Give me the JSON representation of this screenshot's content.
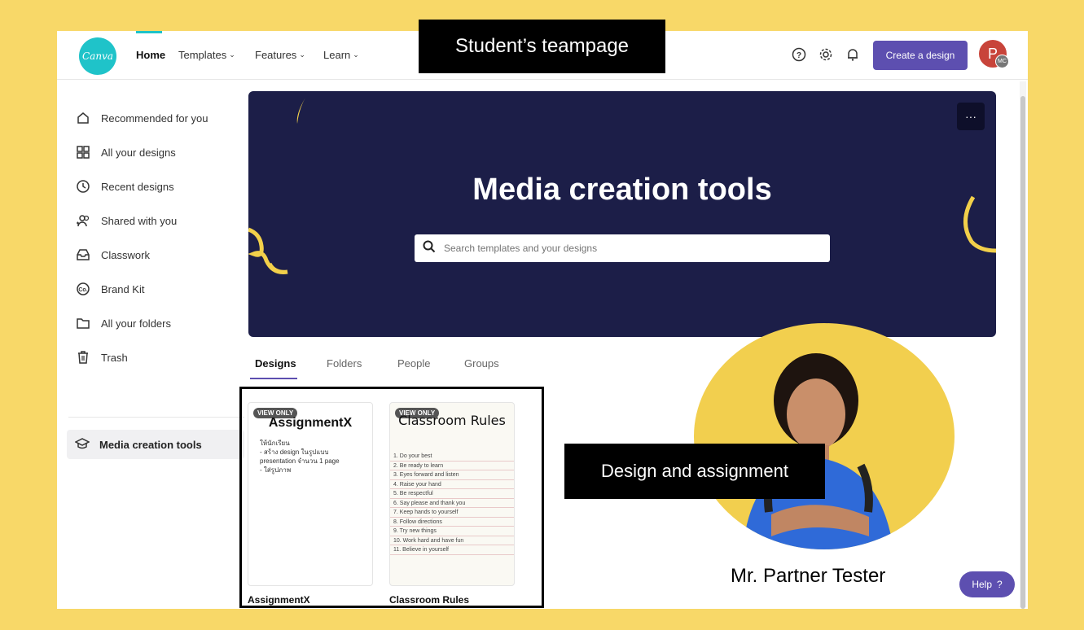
{
  "brand": {
    "logo_text": "Canva",
    "accent": "#5d4fb0",
    "teal": "#1fc3c9",
    "hero_bg": "#1c1e48",
    "page_bg": "#f8d868"
  },
  "overlay": {
    "title": "Student’s teampage",
    "design_label": "Design and assignment"
  },
  "nav": {
    "home": "Home",
    "templates": "Templates",
    "features": "Features",
    "learn": "Learn"
  },
  "top_icons": [
    "help-icon",
    "gear-icon",
    "bell-icon"
  ],
  "create_button": "Create a design",
  "avatar": {
    "initial": "P",
    "team_initials": "MC"
  },
  "sidebar": {
    "items": [
      {
        "label": "Recommended for you",
        "icon": "home-icon"
      },
      {
        "label": "All your designs",
        "icon": "grid-icon"
      },
      {
        "label": "Recent designs",
        "icon": "clock-icon"
      },
      {
        "label": "Shared with you",
        "icon": "shared-users-icon"
      },
      {
        "label": "Classwork",
        "icon": "inbox-icon"
      },
      {
        "label": "Brand Kit",
        "icon": "brand-kit-icon"
      },
      {
        "label": "All your folders",
        "icon": "folder-icon"
      },
      {
        "label": "Trash",
        "icon": "trash-icon"
      }
    ],
    "team": {
      "label": "Media creation tools",
      "icon": "graduation-cap-icon"
    }
  },
  "hero": {
    "title": "Media creation tools",
    "search_placeholder": "Search templates and your designs",
    "more": "···"
  },
  "tabs": [
    "Designs",
    "Folders",
    "People",
    "Groups"
  ],
  "cards": [
    {
      "title": "AssignmentX",
      "badge": "VIEW ONLY",
      "heading": "AssignmentX",
      "lines": [
        "ให้นักเรียน",
        "- สร้าง design ในรูปแบบ",
        "presentation จำนวน 1 page",
        "- ใส่รูปภาพ"
      ]
    },
    {
      "title": "Classroom Rules",
      "badge": "VIEW ONLY",
      "heading": "Classroom Rules",
      "rules": [
        "1. Do your best",
        "2. Be ready to learn",
        "3. Eyes forward and listen",
        "4. Raise your hand",
        "5. Be respectful",
        "6. Say please and thank you",
        "7. Keep hands to yourself",
        "8. Follow directions",
        "9. Try new things",
        "10. Work hard and have fun",
        "11. Believe in yourself"
      ]
    }
  ],
  "person": {
    "name": "Mr. Partner Tester"
  },
  "help": {
    "label": "Help",
    "icon": "?"
  }
}
